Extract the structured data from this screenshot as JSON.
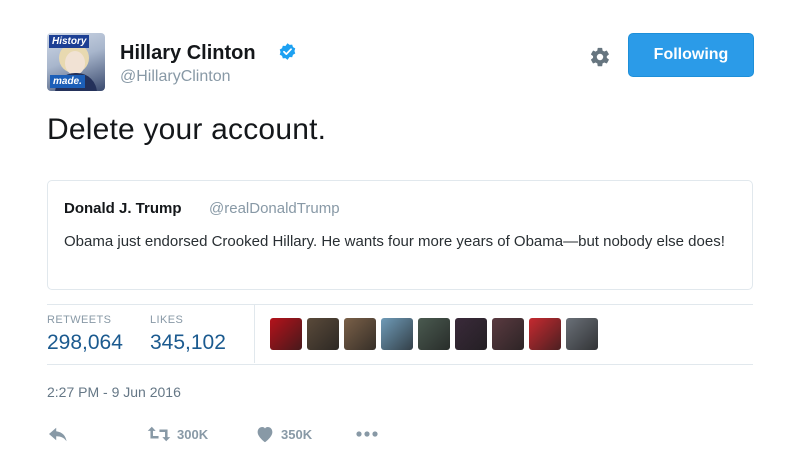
{
  "author": {
    "avatar_badge_top": "History",
    "avatar_badge_bottom": "made.",
    "name": "Hillary Clinton",
    "handle": "@HillaryClinton",
    "verified": true
  },
  "header_actions": {
    "settings_icon": "gear-icon",
    "follow_label": "Following",
    "accent_color": "#2b9be8"
  },
  "tweet": {
    "text": "Delete your account."
  },
  "quoted": {
    "name": "Donald J. Trump",
    "handle": "@realDonaldTrump",
    "text": "Obama just endorsed Crooked Hillary. He wants four more years of Obama—but nobody else does!"
  },
  "stats": {
    "retweets_label": "RETWEETS",
    "retweets_value": "298,064",
    "likes_label": "LIKES",
    "likes_value": "345,102",
    "liker_avatar_colors": [
      "#b5121b",
      "#5a4a3a",
      "#7a6048",
      "#6f9bb8",
      "#4a5a50",
      "#3a2a3a",
      "#5a3a40",
      "#c62a30",
      "#6a7078"
    ]
  },
  "timestamp": "2:27 PM - 9 Jun 2016",
  "actions": {
    "reply_icon": "reply-icon",
    "retweet_icon": "retweet-icon",
    "retweet_count": "300K",
    "like_icon": "heart-icon",
    "like_count": "350K",
    "more_icon": "more-icon",
    "muted_color": "#8899a6"
  }
}
